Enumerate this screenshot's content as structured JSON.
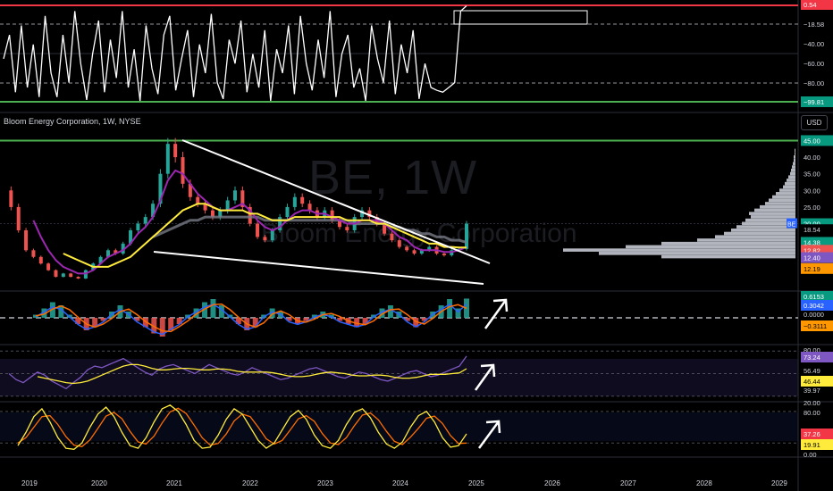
{
  "header": {
    "title": "Bloom Energy Corporation, 1W, NYSE",
    "currency": "USD",
    "watermark_ticker": "BE, 1W",
    "watermark_name": "Bloom Energy Corporation"
  },
  "colors": {
    "background": "#000000",
    "price_up": "#26a69a",
    "price_down": "#ef5350",
    "ma_fast": "#9c27b0",
    "ma_mid": "#ffeb3b",
    "ma_slow": "#787b86",
    "resistance": "#4caf50",
    "wedge": "#ffffff",
    "red_level": "#f23645",
    "volume_profile": "#b2b5be",
    "macd_line": "#2962ff",
    "signal_line": "#ff6d00"
  },
  "chart_data": [
    {
      "type": "line",
      "name": "oscillator",
      "ylim": [
        -99.81,
        0.54
      ],
      "yticks": [
        "−18.58",
        "−40.00",
        "−60.00",
        "−80.00"
      ],
      "price_labels": [
        "0.54",
        "−99.81"
      ],
      "values": [
        -55,
        -30,
        -90,
        -20,
        -85,
        -40,
        -95,
        -10,
        -70,
        -95,
        -30,
        -80,
        -5,
        -60,
        -98,
        -50,
        -15,
        -90,
        -35,
        -75,
        -5,
        -85,
        -45,
        -99,
        -20,
        -65,
        -92,
        -30,
        -10,
        -88,
        -55,
        -25,
        -95,
        -40,
        -70,
        -8,
        -80,
        -97,
        -35,
        -60,
        -15,
        -90,
        -50,
        -85,
        -25,
        -99,
        -45,
        -70,
        -20,
        -92,
        -10,
        -60,
        -88,
        -35,
        -75,
        -5,
        -95,
        -50,
        -30,
        -85,
        -65,
        -99,
        -20,
        -55,
        -80,
        -15,
        -92,
        -40,
        -70,
        -25,
        -97,
        -60,
        -85,
        -88,
        -90,
        -85,
        -80,
        -5,
        0.54
      ]
    },
    {
      "type": "line",
      "name": "BE weekly price",
      "x": [
        "2019",
        "2020",
        "2021",
        "2022",
        "2023",
        "2024",
        "2025",
        "2026",
        "2027",
        "2028",
        "2029"
      ],
      "ylim": [
        0,
        47
      ],
      "yticks": [
        40,
        35,
        30,
        25
      ],
      "price_labels": [
        "45.00",
        "20.00",
        "18.54",
        "14.38",
        "12.82",
        "12.40",
        "12.19"
      ],
      "series": [
        {
          "name": "BE",
          "values": [
            30,
            25,
            18,
            12,
            10,
            8,
            6,
            4,
            5,
            4,
            3.5,
            6,
            8,
            10,
            12,
            11,
            14,
            18,
            20,
            22,
            26,
            35,
            44,
            40,
            32,
            28,
            26,
            24,
            22,
            24,
            27,
            30,
            25,
            20,
            16,
            15,
            18,
            22,
            25,
            28,
            26,
            24,
            22,
            24,
            21,
            19,
            18,
            22,
            24,
            22,
            20,
            17,
            15,
            13,
            12,
            11,
            12,
            13,
            11,
            10.5,
            12,
            12.4,
            20
          ]
        },
        {
          "name": "MA fast",
          "values": [
            null,
            null,
            null,
            null,
            21,
            16,
            12,
            9,
            7,
            6,
            5,
            5,
            6,
            8,
            10,
            11,
            12,
            14,
            17,
            19,
            22,
            27,
            33,
            36,
            35,
            32,
            29,
            27,
            25,
            24,
            24,
            25,
            26,
            24,
            21,
            19,
            18,
            19,
            21,
            23,
            24,
            24,
            23,
            23,
            22,
            21,
            20,
            20,
            21,
            21,
            21,
            20,
            18,
            16,
            15,
            13,
            12,
            12,
            12,
            11.5,
            11.5,
            12,
            13
          ]
        },
        {
          "name": "MA mid",
          "values": [
            null,
            null,
            null,
            null,
            null,
            null,
            null,
            null,
            11,
            10,
            9,
            8,
            7,
            7,
            7,
            8,
            9,
            10,
            12,
            14,
            16,
            18,
            20,
            22,
            24,
            25,
            26,
            26,
            25,
            24,
            24,
            24,
            24,
            23,
            23,
            22,
            21,
            21,
            21,
            22,
            22,
            22,
            22,
            22,
            22,
            22,
            21,
            21,
            21,
            21,
            20,
            20,
            19,
            18,
            17,
            16,
            15,
            14,
            14,
            13,
            13,
            12.8,
            12.82
          ]
        },
        {
          "name": "MA slow",
          "values": [
            null,
            null,
            null,
            null,
            null,
            null,
            null,
            null,
            null,
            null,
            null,
            null,
            null,
            null,
            null,
            null,
            null,
            null,
            null,
            null,
            16,
            17,
            18,
            19,
            20,
            21,
            21,
            22,
            22,
            22,
            22,
            22,
            22,
            22,
            22,
            21,
            21,
            21,
            21,
            21,
            21,
            21,
            21,
            21,
            21,
            21,
            21,
            20,
            20,
            20,
            20,
            20,
            19,
            19,
            18,
            18,
            17,
            17,
            16,
            16,
            15,
            15,
            14.38
          ]
        }
      ]
    },
    {
      "type": "bar",
      "name": "volume profile",
      "bins": [
        42,
        41,
        40,
        39,
        38,
        37,
        36,
        35,
        34,
        33,
        32,
        31,
        30,
        29,
        28,
        27,
        26,
        25,
        24,
        23,
        22,
        21,
        20,
        19,
        18,
        17,
        16,
        15,
        14,
        13,
        12,
        11,
        10
      ],
      "values": [
        1,
        1,
        2,
        2,
        3,
        4,
        5,
        6,
        8,
        10,
        12,
        14,
        18,
        22,
        26,
        30,
        34,
        40,
        46,
        52,
        50,
        56,
        60,
        66,
        72,
        80,
        90,
        110,
        150,
        190,
        260,
        220,
        150
      ]
    },
    {
      "type": "bar",
      "name": "MACD",
      "ylim": [
        -0.3111,
        0.6153
      ],
      "price_labels": [
        "0.6153",
        "0.3042",
        "0.0000",
        "−0.3111"
      ],
      "values": [
        0.1,
        0.3,
        0.5,
        0.4,
        0.1,
        -0.2,
        -0.4,
        -0.3,
        -0.1,
        0.2,
        0.4,
        0.2,
        -0.1,
        -0.3,
        -0.5,
        -0.6,
        -0.4,
        -0.2,
        0.1,
        0.3,
        0.5,
        0.6,
        0.4,
        0.1,
        -0.2,
        -0.4,
        -0.3,
        0.1,
        0.3,
        0.2,
        -0.1,
        -0.2,
        -0.1,
        0.1,
        0.2,
        0.1,
        -0.1,
        -0.2,
        -0.3,
        -0.2,
        0.1,
        0.3,
        0.4,
        0.2,
        -0.1,
        -0.3,
        -0.1,
        0.2,
        0.4,
        0.6,
        0.3,
        0.6153
      ]
    },
    {
      "type": "line",
      "name": "RSI",
      "ylim": [
        20,
        80
      ],
      "yticks": [
        "80.00",
        "20.00"
      ],
      "price_labels": [
        "73.24",
        "56.49",
        "46.44",
        "39.97"
      ],
      "series": [
        {
          "name": "RSI",
          "values": [
            50,
            42,
            38,
            45,
            52,
            48,
            40,
            35,
            30,
            38,
            45,
            55,
            60,
            58,
            62,
            66,
            70,
            64,
            58,
            52,
            48,
            56,
            60,
            62,
            58,
            54,
            50,
            56,
            62,
            58,
            54,
            50,
            48,
            52,
            58,
            54,
            50,
            46,
            42,
            44,
            48,
            52,
            56,
            58,
            54,
            50,
            46,
            44,
            48,
            52,
            50,
            46,
            42,
            40,
            44,
            48,
            52,
            54,
            50,
            46,
            48,
            52,
            56,
            60,
            73.24
          ]
        },
        {
          "name": "RSI MA",
          "values": [
            null,
            null,
            null,
            null,
            46,
            44,
            42,
            40,
            38,
            37,
            38,
            40,
            44,
            48,
            52,
            56,
            60,
            62,
            62,
            60,
            57,
            55,
            55,
            56,
            57,
            57,
            56,
            55,
            55,
            56,
            56,
            55,
            53,
            52,
            52,
            52,
            52,
            51,
            49,
            47,
            46,
            46,
            47,
            49,
            51,
            52,
            51,
            50,
            48,
            47,
            47,
            48,
            48,
            47,
            45,
            44,
            44,
            45,
            47,
            49,
            49,
            49,
            50,
            51,
            56.49
          ]
        }
      ]
    },
    {
      "type": "line",
      "name": "Stochastic",
      "ylim": [
        0,
        80
      ],
      "yticks": [
        "80.00",
        "20.00",
        "0.00"
      ],
      "price_labels": [
        "37.26",
        "19.91"
      ],
      "series": [
        {
          "name": "%K",
          "values": [
            15,
            40,
            70,
            85,
            60,
            30,
            10,
            8,
            20,
            50,
            75,
            88,
            70,
            40,
            15,
            10,
            30,
            60,
            85,
            92,
            80,
            55,
            25,
            10,
            12,
            35,
            65,
            85,
            75,
            50,
            25,
            10,
            20,
            45,
            70,
            82,
            65,
            35,
            15,
            10,
            25,
            55,
            78,
            85,
            68,
            40,
            18,
            10,
            22,
            50,
            72,
            80,
            60,
            30,
            12,
            15,
            37.26
          ]
        },
        {
          "name": "%D",
          "values": [
            20,
            30,
            50,
            70,
            72,
            55,
            32,
            16,
            13,
            26,
            48,
            71,
            78,
            66,
            42,
            22,
            18,
            33,
            58,
            79,
            86,
            76,
            54,
            30,
            16,
            19,
            37,
            62,
            75,
            70,
            50,
            28,
            18,
            25,
            45,
            66,
            72,
            61,
            38,
            20,
            17,
            30,
            53,
            73,
            77,
            64,
            42,
            23,
            17,
            31,
            48,
            67,
            71,
            57,
            34,
            19,
            19.91
          ]
        }
      ]
    }
  ],
  "x_axis": [
    "2019",
    "2020",
    "2021",
    "2022",
    "2023",
    "2024",
    "2025",
    "2026",
    "2027",
    "2028",
    "2029"
  ]
}
